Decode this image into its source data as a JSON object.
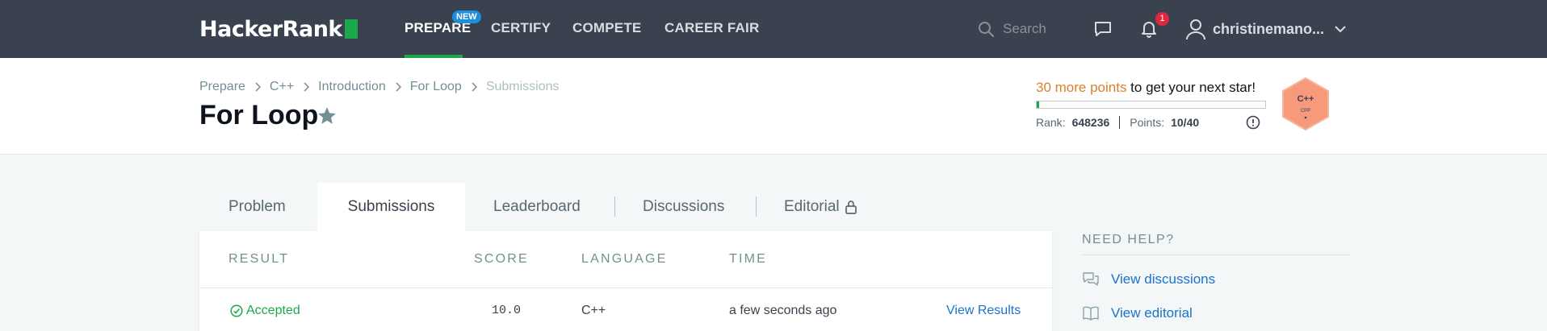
{
  "nav": {
    "logo": "HackerRank",
    "items": [
      "PREPARE",
      "CERTIFY",
      "COMPETE",
      "CAREER FAIR"
    ],
    "new_badge": "NEW",
    "search_placeholder": "Search",
    "notification_count": "1",
    "username": "christinemano...",
    "colors": {
      "bg": "#39424e",
      "accent": "#1ba94c",
      "badge": "#1d8ddd",
      "alert": "#e2263e"
    }
  },
  "header": {
    "breadcrumb": [
      "Prepare",
      "C++",
      "Introduction",
      "For Loop",
      "Submissions"
    ],
    "title": "For Loop",
    "points_highlight": "30 more points",
    "points_rest": " to get your next star!",
    "progress_fraction": 0.01,
    "rank_label": "Rank:",
    "rank_value": "648236",
    "points_label": "Points:",
    "points_value": "10/40",
    "badge_main": "C++",
    "badge_sub": "CPP"
  },
  "tabs": [
    "Problem",
    "Submissions",
    "Leaderboard",
    "Discussions",
    "Editorial"
  ],
  "table": {
    "headers": [
      "RESULT",
      "SCORE",
      "LANGUAGE",
      "TIME"
    ],
    "rows": [
      {
        "result": "Accepted",
        "score": "10.0",
        "language": "C++",
        "time": "a few seconds ago",
        "action": "View Results"
      }
    ]
  },
  "help": {
    "title": "NEED HELP?",
    "links": [
      "View discussions",
      "View editorial"
    ]
  }
}
